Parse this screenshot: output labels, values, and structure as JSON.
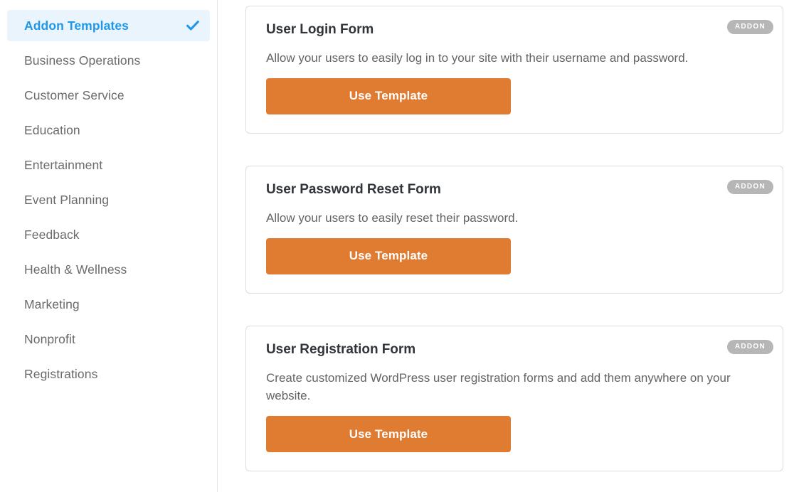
{
  "sidebar": {
    "items": [
      {
        "label": "Addon Templates",
        "active": true,
        "icon": "check-icon"
      },
      {
        "label": "Business Operations",
        "active": false
      },
      {
        "label": "Customer Service",
        "active": false
      },
      {
        "label": "Education",
        "active": false
      },
      {
        "label": "Entertainment",
        "active": false
      },
      {
        "label": "Event Planning",
        "active": false
      },
      {
        "label": "Feedback",
        "active": false
      },
      {
        "label": "Health & Wellness",
        "active": false
      },
      {
        "label": "Marketing",
        "active": false
      },
      {
        "label": "Nonprofit",
        "active": false
      },
      {
        "label": "Registrations",
        "active": false
      }
    ]
  },
  "main": {
    "templates": [
      {
        "title": "User Login Form",
        "description": "Allow your users to easily log in to your site with their username and password.",
        "badge": "Addon",
        "button_label": "Use Template"
      },
      {
        "title": "User Password Reset Form",
        "description": "Allow your users to easily reset their password.",
        "badge": "Addon",
        "button_label": "Use Template"
      },
      {
        "title": "User Registration Form",
        "description": "Create customized WordPress user registration forms and add them anywhere on your website.",
        "badge": "Addon",
        "button_label": "Use Template"
      }
    ]
  },
  "colors": {
    "accent_blue": "#1f98ea",
    "active_bg": "#eaf4fd",
    "button_orange": "#e07b32",
    "badge_gray": "#b6b6b6",
    "text_gray": "#6a6a6a",
    "title_dark": "#31353b",
    "border": "#dddddd"
  }
}
